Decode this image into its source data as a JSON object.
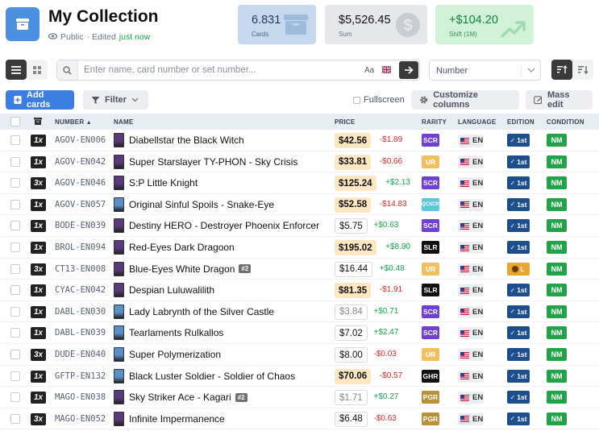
{
  "header": {
    "title": "My Collection",
    "visibility": "Public",
    "edited_prefix": "· Edited",
    "edited_when": "just now"
  },
  "stats": [
    {
      "value": "6.831",
      "label": "Cards"
    },
    {
      "value": "$5,526.45",
      "label": "Sum"
    },
    {
      "value": "+$104.20",
      "label": "Shift (1M)"
    }
  ],
  "search": {
    "placeholder": "Enter name, card number or set number...",
    "case_toggle": "Aa"
  },
  "sort": {
    "selected": "Number"
  },
  "toolbar": {
    "add_cards": "Add cards",
    "filter": "Filter",
    "fullscreen": "Fullscreen",
    "customize": "Customize columns",
    "mass_edit": "Mass edit"
  },
  "columns": {
    "number": "NUMBER",
    "name": "NAME",
    "price": "PRICE",
    "rarity": "RARITY",
    "language": "LANGUAGE",
    "edition": "EDITION",
    "condition": "CONDITION"
  },
  "colors": {
    "SCR": "#6f3fd6",
    "UR": "#f0c060",
    "QCSCR": "#5bc8d9",
    "SLR": "#111111",
    "GHR": "#111111",
    "PGR": "#b8923a",
    "thumb_dark": "#5a3a7a",
    "thumb_light": "#5b8fc9"
  },
  "rows": [
    {
      "qty": "1x",
      "number": "AGOV-EN006",
      "name": "Diabellstar the Black Witch",
      "price": "$42.56",
      "price_style": "hi",
      "change": "-$1.89",
      "rarity": "SCR",
      "lang": "EN",
      "edition": "1st",
      "condition": "NM",
      "thumb": "thumb_dark"
    },
    {
      "qty": "1x",
      "number": "AGOV-EN042",
      "name": "Super Starslayer TY-PHON - Sky Crisis",
      "price": "$33.81",
      "price_style": "hi",
      "change": "-$0.66",
      "rarity": "UR",
      "lang": "EN",
      "edition": "1st",
      "condition": "NM",
      "thumb": "thumb_dark"
    },
    {
      "qty": "3x",
      "number": "AGOV-EN046",
      "name": "S:P Little Knight",
      "price": "$125.24",
      "price_style": "hi",
      "change": "+$2.13",
      "rarity": "SCR",
      "lang": "EN",
      "edition": "1st",
      "condition": "NM",
      "thumb": "thumb_dark"
    },
    {
      "qty": "1x",
      "number": "AGOV-EN057",
      "name": "Original Sinful Spoils - Snake-Eye",
      "price": "$52.58",
      "price_style": "hi",
      "change": "-$14.83",
      "rarity": "QCSCR",
      "lang": "EN",
      "edition": "1st",
      "condition": "NM",
      "thumb": "thumb_light"
    },
    {
      "qty": "1x",
      "number": "BODE-EN039",
      "name": "Destiny HERO - Destroyer Phoenix Enforcer",
      "price": "$5.75",
      "price_style": "lo",
      "change": "+$0.63",
      "rarity": "SCR",
      "lang": "EN",
      "edition": "1st",
      "condition": "NM",
      "thumb": "thumb_dark"
    },
    {
      "qty": "1x",
      "number": "BROL-EN094",
      "name": "Red-Eyes Dark Dragoon",
      "price": "$195.02",
      "price_style": "hi",
      "change": "+$8.90",
      "rarity": "SLR",
      "lang": "EN",
      "edition": "1st",
      "condition": "NM",
      "thumb": "thumb_dark"
    },
    {
      "qty": "3x",
      "number": "CT13-EN008",
      "name": "Blue-Eyes White Dragon",
      "variant": "#2",
      "price": "$16.44",
      "price_style": "lo",
      "change": "+$0.48",
      "rarity": "UR",
      "lang": "EN",
      "edition": "L",
      "condition": "NM",
      "thumb": "thumb_dark"
    },
    {
      "qty": "1x",
      "number": "CYAC-EN042",
      "name": "Despian Luluwalilith",
      "price": "$81.35",
      "price_style": "hi",
      "change": "-$1.91",
      "rarity": "SLR",
      "lang": "EN",
      "edition": "1st",
      "condition": "NM",
      "thumb": "thumb_dark"
    },
    {
      "qty": "1x",
      "number": "DABL-EN030",
      "name": "Lady Labrynth of the Silver Castle",
      "price": "$3.84",
      "price_style": "lo gray",
      "change": "+$0.71",
      "rarity": "SCR",
      "lang": "EN",
      "edition": "1st",
      "condition": "NM",
      "thumb": "thumb_light"
    },
    {
      "qty": "1x",
      "number": "DABL-EN039",
      "name": "Tearlaments Rulkallos",
      "price": "$7.02",
      "price_style": "lo",
      "change": "+$2.47",
      "rarity": "SCR",
      "lang": "EN",
      "edition": "1st",
      "condition": "NM",
      "thumb": "thumb_light"
    },
    {
      "qty": "3x",
      "number": "DUDE-EN040",
      "name": "Super Polymerization",
      "price": "$8.00",
      "price_style": "lo",
      "change": "-$0.03",
      "rarity": "UR",
      "lang": "EN",
      "edition": "1st",
      "condition": "NM",
      "thumb": "thumb_light"
    },
    {
      "qty": "1x",
      "number": "GFTP-EN132",
      "name": "Black Luster Soldier - Soldier of Chaos",
      "price": "$70.06",
      "price_style": "hi",
      "change": "-$0.57",
      "rarity": "GHR",
      "lang": "EN",
      "edition": "1st",
      "condition": "NM",
      "thumb": "thumb_light"
    },
    {
      "qty": "1x",
      "number": "MAGO-EN038",
      "name": "Sky Striker Ace - Kagari",
      "variant": "#2",
      "price": "$1.71",
      "price_style": "lo gray",
      "change": "+$0.27",
      "rarity": "PGR",
      "lang": "EN",
      "edition": "1st",
      "condition": "NM",
      "thumb": "thumb_dark"
    },
    {
      "qty": "3x",
      "number": "MAGO-EN052",
      "name": "Infinite Impermanence",
      "price": "$6.48",
      "price_style": "lo",
      "change": "-$0.63",
      "rarity": "PGR",
      "lang": "EN",
      "edition": "1st",
      "condition": "NM",
      "thumb": "thumb_dark"
    }
  ]
}
